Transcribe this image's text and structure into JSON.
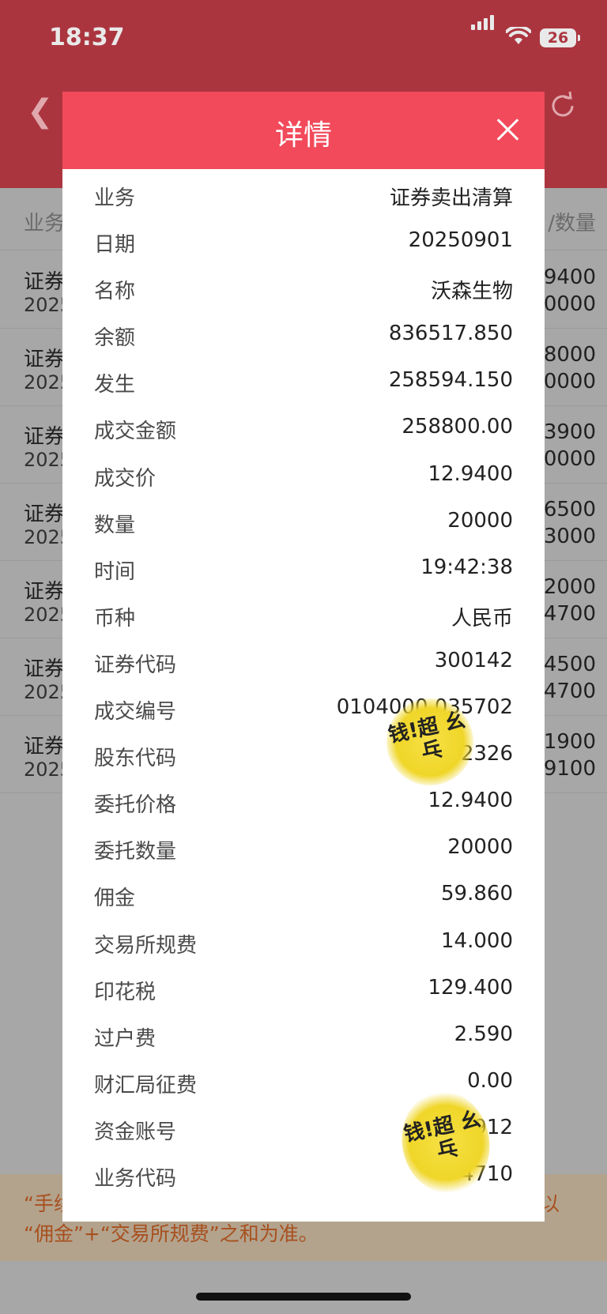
{
  "status": {
    "time": "18:37",
    "battery": "26"
  },
  "background": {
    "col_left": "业务",
    "col_right": "/数量",
    "rows": [
      {
        "a": "证券",
        "b": "2025",
        "c": "9400",
        "d": "0000"
      },
      {
        "a": "证券",
        "b": "2025",
        "c": "8000",
        "d": "0000"
      },
      {
        "a": "证券",
        "b": "2025",
        "c": "3900",
        "d": "0000"
      },
      {
        "a": "证券",
        "b": "2025",
        "c": "6500",
        "d": "3000"
      },
      {
        "a": "证券",
        "b": "2025",
        "c": "2000",
        "d": "4700"
      },
      {
        "a": "证券",
        "b": "2025",
        "c": "4500",
        "d": "4700"
      },
      {
        "a": "证券",
        "b": "2025",
        "c": "1900",
        "d": "9100"
      }
    ],
    "notice_line1_left": "“手续",
    "notice_line1_right": "以",
    "notice_line2": "“佣金”+“交易所规费”之和为准。"
  },
  "modal": {
    "title": "详情",
    "rows": [
      {
        "label": "业务",
        "value": "证券卖出清算"
      },
      {
        "label": "日期",
        "value": "20250901"
      },
      {
        "label": "名称",
        "value": "沃森生物"
      },
      {
        "label": "余额",
        "value": "836517.850"
      },
      {
        "label": "发生",
        "value": "258594.150"
      },
      {
        "label": "成交金额",
        "value": "258800.00"
      },
      {
        "label": "成交价",
        "value": "12.9400"
      },
      {
        "label": "数量",
        "value": "20000"
      },
      {
        "label": "时间",
        "value": "19:42:38"
      },
      {
        "label": "币种",
        "value": "人民币"
      },
      {
        "label": "证券代码",
        "value": "300142"
      },
      {
        "label": "成交编号",
        "value": "0104000   035702"
      },
      {
        "label": "股东代码",
        "value": "02     2326"
      },
      {
        "label": "委托价格",
        "value": "12.9400"
      },
      {
        "label": "委托数量",
        "value": "20000"
      },
      {
        "label": "佣金",
        "value": "59.860"
      },
      {
        "label": "交易所规费",
        "value": "14.000"
      },
      {
        "label": "印花税",
        "value": "129.400"
      },
      {
        "label": "过户费",
        "value": "2.590"
      },
      {
        "label": "财汇局征费",
        "value": "0.00"
      },
      {
        "label": "资金账号",
        "value": "15     5912"
      },
      {
        "label": "业务代码",
        "value": "     4710"
      }
    ]
  },
  "stickers": [
    {
      "text": "钱!超 幺乓"
    },
    {
      "text": "钱!超 幺乓"
    }
  ]
}
